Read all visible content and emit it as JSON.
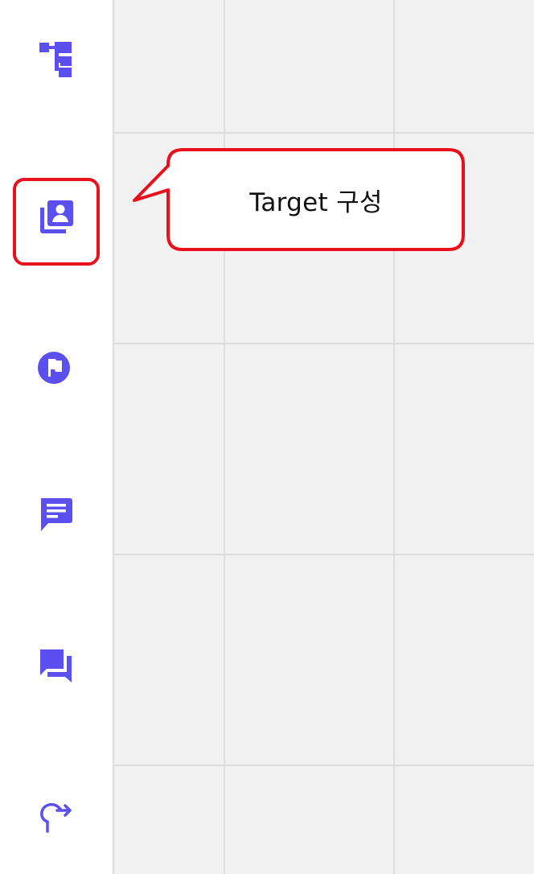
{
  "sidebar": {
    "items": [
      {
        "icon": "hierarchy-icon",
        "label": ""
      },
      {
        "icon": "target-contacts-icon",
        "label": ""
      },
      {
        "icon": "flag-circle-icon",
        "label": ""
      },
      {
        "icon": "message-icon",
        "label": ""
      },
      {
        "icon": "forum-icon",
        "label": ""
      },
      {
        "icon": "redirect-arrow-icon",
        "label": ""
      }
    ]
  },
  "callout": {
    "text": "Target 구성"
  },
  "colors": {
    "icon": "#5b4ff0",
    "highlight": "#e8101c",
    "sidebar_bg": "#ffffff",
    "canvas_bg": "#f1f1f1",
    "grid_line": "#dddddd"
  }
}
